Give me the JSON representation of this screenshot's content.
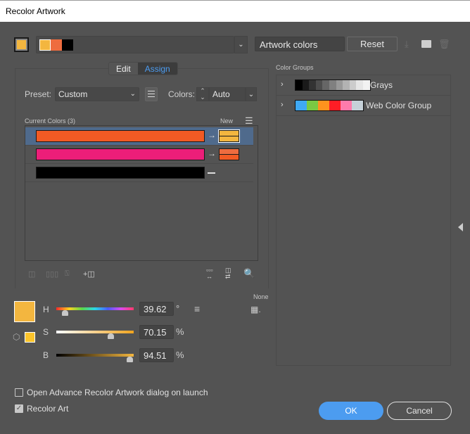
{
  "window": {
    "title": "Recolor Artwork"
  },
  "top": {
    "active_color": "#f3b63f",
    "harmony_colors": [
      "#f3b63f",
      "#ee6c3f",
      "#000000"
    ],
    "artwork_name": "Artwork colors",
    "reset_label": "Reset"
  },
  "tabs": [
    {
      "label": "Edit",
      "active": false
    },
    {
      "label": "Assign",
      "active": true
    }
  ],
  "preset": {
    "label": "Preset:",
    "value": "Custom"
  },
  "colors": {
    "label": "Colors:",
    "value": "Auto"
  },
  "list": {
    "current_label": "Current Colors (3)",
    "new_label": "New",
    "rows": [
      {
        "current": "#f15a24",
        "new": [
          "#f3b63f",
          "#f3b63f"
        ],
        "selected": true
      },
      {
        "current": "#ec1e79",
        "new": [
          "#ee6c3f",
          "#f15a24"
        ],
        "selected": false
      },
      {
        "current": "#000000",
        "new": null,
        "selected": false
      }
    ]
  },
  "hsb": {
    "fill_color": "#f3b63f",
    "stroke_color": "#fcc42b",
    "h": {
      "label": "H",
      "value": "39.62",
      "unit": "°",
      "fraction": 0.11
    },
    "s": {
      "label": "S",
      "value": "70.15",
      "unit": "%",
      "fraction": 0.7
    },
    "b": {
      "label": "B",
      "value": "94.51",
      "unit": "%",
      "fraction": 0.95
    }
  },
  "none_label": "None",
  "color_groups": {
    "label": "Color Groups",
    "groups": [
      {
        "name": "Grays",
        "colors": [
          "#000000",
          "#1a1a1a",
          "#333333",
          "#4d4d4d",
          "#666666",
          "#808080",
          "#999999",
          "#b3b3b3",
          "#cccccc",
          "#e6e6e6",
          "#f2f2f2"
        ]
      },
      {
        "name": "Web Color Group",
        "colors": [
          "#3fa9f5",
          "#7ac943",
          "#ff931e",
          "#ff1d25",
          "#ff7bac",
          "#c6d1d9"
        ]
      }
    ]
  },
  "options": {
    "advance_label": "Open Advance Recolor Artwork dialog on launch",
    "advance_checked": false,
    "recolor_label": "Recolor Art",
    "recolor_checked": true
  },
  "buttons": {
    "ok": "OK",
    "cancel": "Cancel"
  }
}
